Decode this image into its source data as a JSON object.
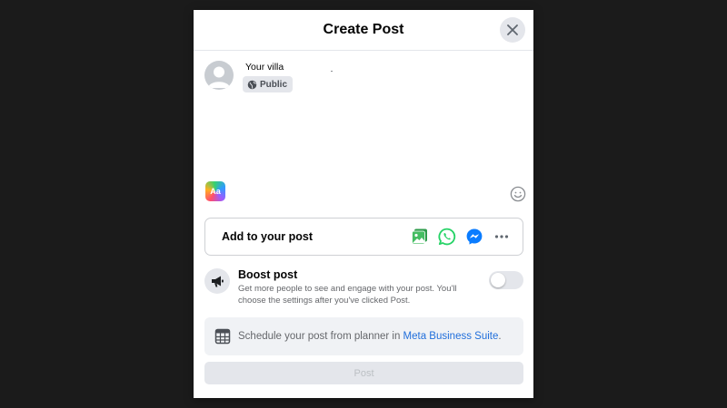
{
  "modal": {
    "title": "Create Post"
  },
  "author": {
    "name": "Your villa",
    "audience_label": "Public"
  },
  "text_format": {
    "label": "Aa"
  },
  "add_to_post": {
    "label": "Add to your post",
    "icons": [
      "photo-video-icon",
      "whatsapp-icon",
      "messenger-icon",
      "more-icon"
    ]
  },
  "boost": {
    "title": "Boost post",
    "description": "Get more people to see and engage with your post. You'll choose the settings after you've clicked Post.",
    "enabled": false
  },
  "schedule": {
    "text_prefix": "Schedule your post from planner in ",
    "link_text": "Meta Business Suite",
    "text_suffix": "."
  },
  "post_button": {
    "label": "Post",
    "disabled": true
  },
  "colors": {
    "background": "#1b1b1b",
    "accent_green": "#45bd62",
    "whatsapp": "#25d366",
    "messenger": "#0a7cff",
    "link": "#216fdb"
  }
}
